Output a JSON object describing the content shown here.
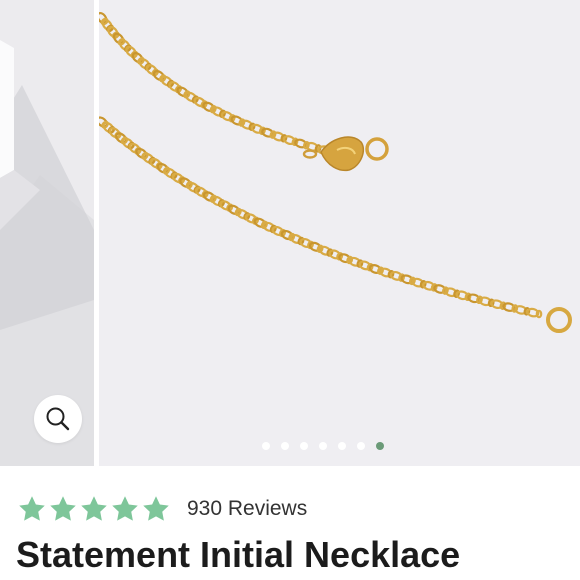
{
  "gallery": {
    "main_image_alt": "Gold cable chain with lobster clasp",
    "zoom_icon": "magnifier-icon",
    "dots_total": 7,
    "active_dot": 6,
    "active_color": "#6b9a78"
  },
  "product": {
    "rating_stars": 5,
    "star_color": "#7ec69a",
    "reviews_label": "930 Reviews",
    "title": "Statement Initial Necklace"
  }
}
